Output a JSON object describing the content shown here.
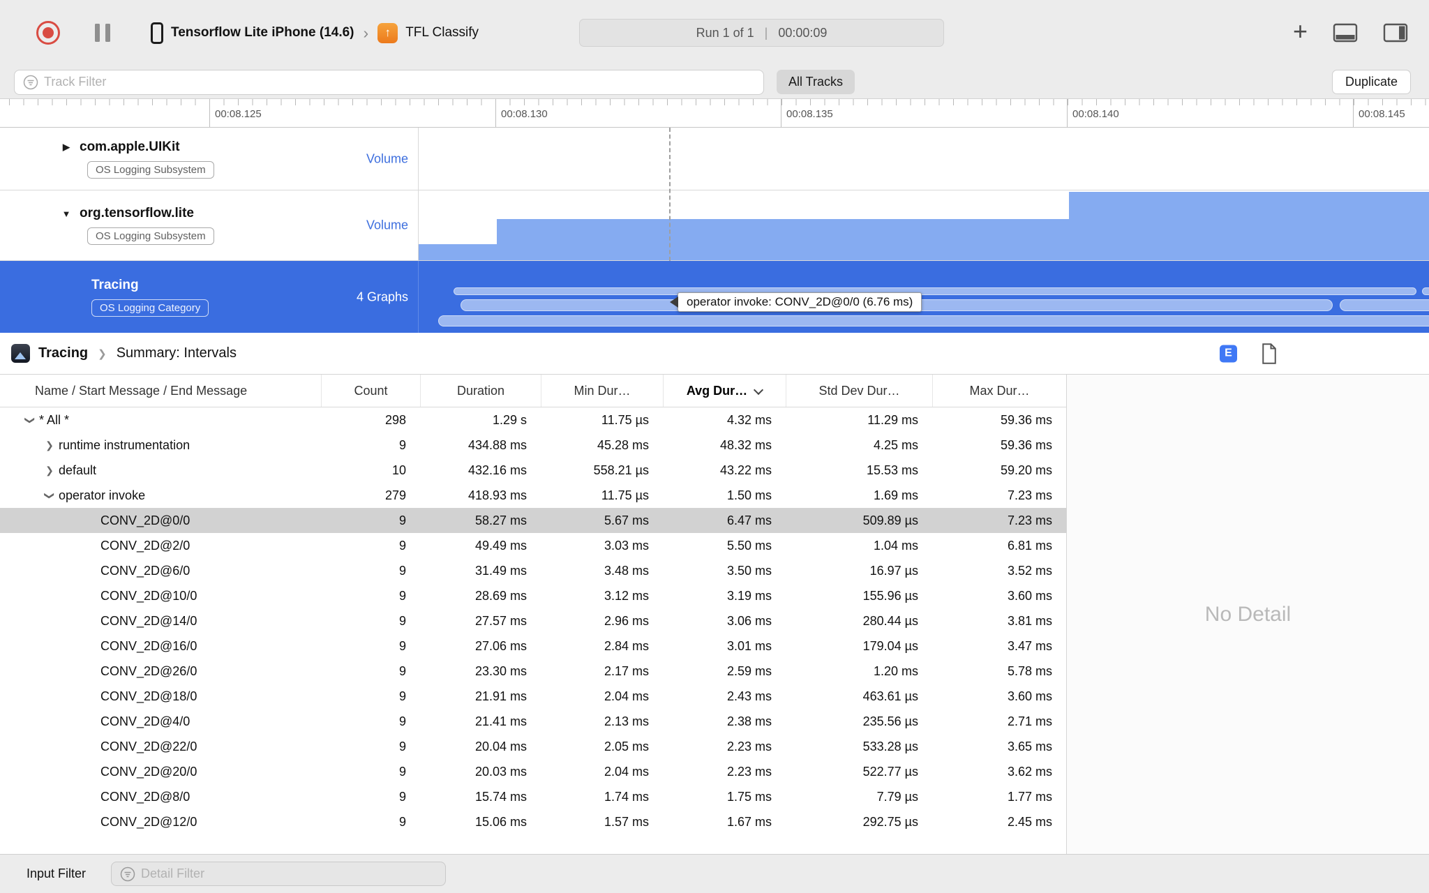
{
  "toolbar": {
    "device_name": "Tensorflow Lite iPhone (14.6)",
    "app_name": "TFL Classify",
    "run_label": "Run 1 of 1",
    "separator": "|",
    "elapsed": "00:00:09"
  },
  "filter_bar": {
    "track_filter_placeholder": "Track Filter",
    "all_tracks": "All Tracks",
    "duplicate": "Duplicate"
  },
  "timeline": {
    "ruler_labels": [
      "00:08.125",
      "00:08.130",
      "00:08.135",
      "00:08.140",
      "00:08.145"
    ],
    "tooltip": "operator invoke: CONV_2D@0/0 (6.76 ms)",
    "tracks": [
      {
        "name": "com.apple.UIKit",
        "badge": "OS Logging Subsystem",
        "meta": "Volume"
      },
      {
        "name": "org.tensorflow.lite",
        "badge": "OS Logging Subsystem",
        "meta": "Volume"
      },
      {
        "name": "Tracing",
        "badge": "OS Logging Category",
        "meta": "4 Graphs"
      }
    ]
  },
  "detail_pane": {
    "breadcrumb_root": "Tracing",
    "breadcrumb_page": "Summary: Intervals",
    "no_detail": "No Detail"
  },
  "table": {
    "headers": {
      "name": "Name / Start Message / End Message",
      "count": "Count",
      "duration": "Duration",
      "min": "Min Dur…",
      "avg": "Avg Dur…",
      "std": "Std Dev Dur…",
      "max": "Max Dur…"
    },
    "sorted_column": "Avg Dur…",
    "rows": [
      {
        "name": "* All *",
        "indent": 0,
        "disclosure": "expanded",
        "count": "298",
        "duration": "1.29 s",
        "min": "11.75 µs",
        "avg": "4.32 ms",
        "std": "11.29 ms",
        "max": "59.36 ms"
      },
      {
        "name": "runtime instrumentation",
        "indent": 1,
        "disclosure": "collapsed",
        "count": "9",
        "duration": "434.88 ms",
        "min": "45.28 ms",
        "avg": "48.32 ms",
        "std": "4.25 ms",
        "max": "59.36 ms"
      },
      {
        "name": "default",
        "indent": 1,
        "disclosure": "collapsed",
        "count": "10",
        "duration": "432.16 ms",
        "min": "558.21 µs",
        "avg": "43.22 ms",
        "std": "15.53 ms",
        "max": "59.20 ms"
      },
      {
        "name": "operator invoke",
        "indent": 1,
        "disclosure": "expanded",
        "count": "279",
        "duration": "418.93 ms",
        "min": "11.75 µs",
        "avg": "1.50 ms",
        "std": "1.69 ms",
        "max": "7.23 ms"
      },
      {
        "name": "CONV_2D@0/0",
        "indent": 2,
        "disclosure": "none",
        "selected": true,
        "count": "9",
        "duration": "58.27 ms",
        "min": "5.67 ms",
        "avg": "6.47 ms",
        "std": "509.89 µs",
        "max": "7.23 ms"
      },
      {
        "name": "CONV_2D@2/0",
        "indent": 2,
        "disclosure": "none",
        "count": "9",
        "duration": "49.49 ms",
        "min": "3.03 ms",
        "avg": "5.50 ms",
        "std": "1.04 ms",
        "max": "6.81 ms"
      },
      {
        "name": "CONV_2D@6/0",
        "indent": 2,
        "disclosure": "none",
        "count": "9",
        "duration": "31.49 ms",
        "min": "3.48 ms",
        "avg": "3.50 ms",
        "std": "16.97 µs",
        "max": "3.52 ms"
      },
      {
        "name": "CONV_2D@10/0",
        "indent": 2,
        "disclosure": "none",
        "count": "9",
        "duration": "28.69 ms",
        "min": "3.12 ms",
        "avg": "3.19 ms",
        "std": "155.96 µs",
        "max": "3.60 ms"
      },
      {
        "name": "CONV_2D@14/0",
        "indent": 2,
        "disclosure": "none",
        "count": "9",
        "duration": "27.57 ms",
        "min": "2.96 ms",
        "avg": "3.06 ms",
        "std": "280.44 µs",
        "max": "3.81 ms"
      },
      {
        "name": "CONV_2D@16/0",
        "indent": 2,
        "disclosure": "none",
        "count": "9",
        "duration": "27.06 ms",
        "min": "2.84 ms",
        "avg": "3.01 ms",
        "std": "179.04 µs",
        "max": "3.47 ms"
      },
      {
        "name": "CONV_2D@26/0",
        "indent": 2,
        "disclosure": "none",
        "count": "9",
        "duration": "23.30 ms",
        "min": "2.17 ms",
        "avg": "2.59 ms",
        "std": "1.20 ms",
        "max": "5.78 ms"
      },
      {
        "name": "CONV_2D@18/0",
        "indent": 2,
        "disclosure": "none",
        "count": "9",
        "duration": "21.91 ms",
        "min": "2.04 ms",
        "avg": "2.43 ms",
        "std": "463.61 µs",
        "max": "3.60 ms"
      },
      {
        "name": "CONV_2D@4/0",
        "indent": 2,
        "disclosure": "none",
        "count": "9",
        "duration": "21.41 ms",
        "min": "2.13 ms",
        "avg": "2.38 ms",
        "std": "235.56 µs",
        "max": "2.71 ms"
      },
      {
        "name": "CONV_2D@22/0",
        "indent": 2,
        "disclosure": "none",
        "count": "9",
        "duration": "20.04 ms",
        "min": "2.05 ms",
        "avg": "2.23 ms",
        "std": "533.28 µs",
        "max": "3.65 ms"
      },
      {
        "name": "CONV_2D@20/0",
        "indent": 2,
        "disclosure": "none",
        "count": "9",
        "duration": "20.03 ms",
        "min": "2.04 ms",
        "avg": "2.23 ms",
        "std": "522.77 µs",
        "max": "3.62 ms"
      },
      {
        "name": "CONV_2D@8/0",
        "indent": 2,
        "disclosure": "none",
        "count": "9",
        "duration": "15.74 ms",
        "min": "1.74 ms",
        "avg": "1.75 ms",
        "std": "7.79 µs",
        "max": "1.77 ms"
      },
      {
        "name": "CONV_2D@12/0",
        "indent": 2,
        "disclosure": "none",
        "count": "9",
        "duration": "15.06 ms",
        "min": "1.57 ms",
        "avg": "1.67 ms",
        "std": "292.75 µs",
        "max": "2.45 ms"
      }
    ]
  },
  "bottom_bar": {
    "input_filter": "Input Filter",
    "detail_filter_placeholder": "Detail Filter"
  },
  "icons": {
    "triangle_right": "▶",
    "triangle_down": "▼",
    "target_chevron": "›",
    "breadcrumb_chevron": "❯",
    "plus": "+",
    "e_badge": "E",
    "app_arrow": "↑"
  },
  "colors": {
    "selection_blue": "#3a6de0",
    "volume_blue": "#85abf1",
    "capsule_blue": "#9cb8f1",
    "selected_row_gray": "#d2d2d2",
    "accent_text_blue": "#3e6fde",
    "record_red": "#d94c43",
    "app_icon_orange": "#ec7a1c"
  }
}
